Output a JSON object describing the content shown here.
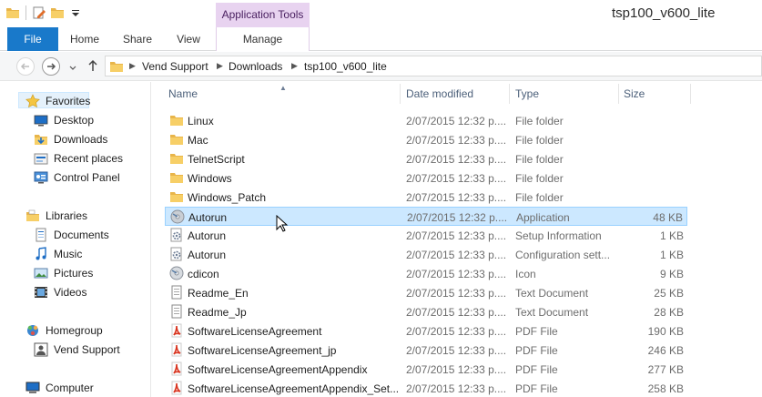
{
  "window": {
    "title": "tsp100_v600_lite",
    "context_tab_group": "Application Tools"
  },
  "ribbon": {
    "tabs": [
      {
        "label": "File"
      },
      {
        "label": "Home"
      },
      {
        "label": "Share"
      },
      {
        "label": "View"
      },
      {
        "label": "Manage"
      }
    ]
  },
  "address": {
    "breadcrumbs": [
      "Vend Support",
      "Downloads",
      "tsp100_v600_lite"
    ]
  },
  "nav": {
    "favorites": {
      "label": "Favorites",
      "items": [
        {
          "label": "Desktop",
          "icon": "desktop-icon"
        },
        {
          "label": "Downloads",
          "icon": "downloads-icon"
        },
        {
          "label": "Recent places",
          "icon": "recent-places-icon"
        },
        {
          "label": "Control Panel",
          "icon": "control-panel-icon"
        }
      ]
    },
    "libraries": {
      "label": "Libraries",
      "items": [
        {
          "label": "Documents",
          "icon": "documents-icon"
        },
        {
          "label": "Music",
          "icon": "music-icon"
        },
        {
          "label": "Pictures",
          "icon": "pictures-icon"
        },
        {
          "label": "Videos",
          "icon": "videos-icon"
        }
      ]
    },
    "homegroup": {
      "label": "Homegroup",
      "items": [
        {
          "label": "Vend Support",
          "icon": "user-icon"
        }
      ]
    },
    "computer": {
      "label": "Computer"
    }
  },
  "columns": {
    "name": "Name",
    "date": "Date modified",
    "type": "Type",
    "size": "Size"
  },
  "files": [
    {
      "name": "Linux",
      "date": "2/07/2015 12:32 p....",
      "type": "File folder",
      "size": "",
      "icon": "folder-icon"
    },
    {
      "name": "Mac",
      "date": "2/07/2015 12:33 p....",
      "type": "File folder",
      "size": "",
      "icon": "folder-icon"
    },
    {
      "name": "TelnetScript",
      "date": "2/07/2015 12:33 p....",
      "type": "File folder",
      "size": "",
      "icon": "folder-icon"
    },
    {
      "name": "Windows",
      "date": "2/07/2015 12:33 p....",
      "type": "File folder",
      "size": "",
      "icon": "folder-icon"
    },
    {
      "name": "Windows_Patch",
      "date": "2/07/2015 12:33 p....",
      "type": "File folder",
      "size": "",
      "icon": "folder-icon"
    },
    {
      "name": "Autorun",
      "date": "2/07/2015 12:32 p....",
      "type": "Application",
      "size": "48 KB",
      "icon": "application-icon"
    },
    {
      "name": "Autorun",
      "date": "2/07/2015 12:33 p....",
      "type": "Setup Information",
      "size": "1 KB",
      "icon": "settings-file-icon"
    },
    {
      "name": "Autorun",
      "date": "2/07/2015 12:33 p....",
      "type": "Configuration sett...",
      "size": "1 KB",
      "icon": "settings-file-icon"
    },
    {
      "name": "cdicon",
      "date": "2/07/2015 12:33 p....",
      "type": "Icon",
      "size": "9 KB",
      "icon": "cd-icon"
    },
    {
      "name": "Readme_En",
      "date": "2/07/2015 12:33 p....",
      "type": "Text Document",
      "size": "25 KB",
      "icon": "text-file-icon"
    },
    {
      "name": "Readme_Jp",
      "date": "2/07/2015 12:33 p....",
      "type": "Text Document",
      "size": "28 KB",
      "icon": "text-file-icon"
    },
    {
      "name": "SoftwareLicenseAgreement",
      "date": "2/07/2015 12:33 p....",
      "type": "PDF File",
      "size": "190 KB",
      "icon": "pdf-icon"
    },
    {
      "name": "SoftwareLicenseAgreement_jp",
      "date": "2/07/2015 12:33 p....",
      "type": "PDF File",
      "size": "246 KB",
      "icon": "pdf-icon"
    },
    {
      "name": "SoftwareLicenseAgreementAppendix",
      "date": "2/07/2015 12:33 p....",
      "type": "PDF File",
      "size": "277 KB",
      "icon": "pdf-icon"
    },
    {
      "name": "SoftwareLicenseAgreementAppendix_Set...",
      "date": "2/07/2015 12:33 p....",
      "type": "PDF File",
      "size": "258 KB",
      "icon": "pdf-icon"
    }
  ],
  "selected_index": 5,
  "colors": {
    "file_tab": "#1979ca",
    "context_tab": "#e8d3f0",
    "selection": "#cce8ff",
    "selection_border": "#99d1ff"
  }
}
